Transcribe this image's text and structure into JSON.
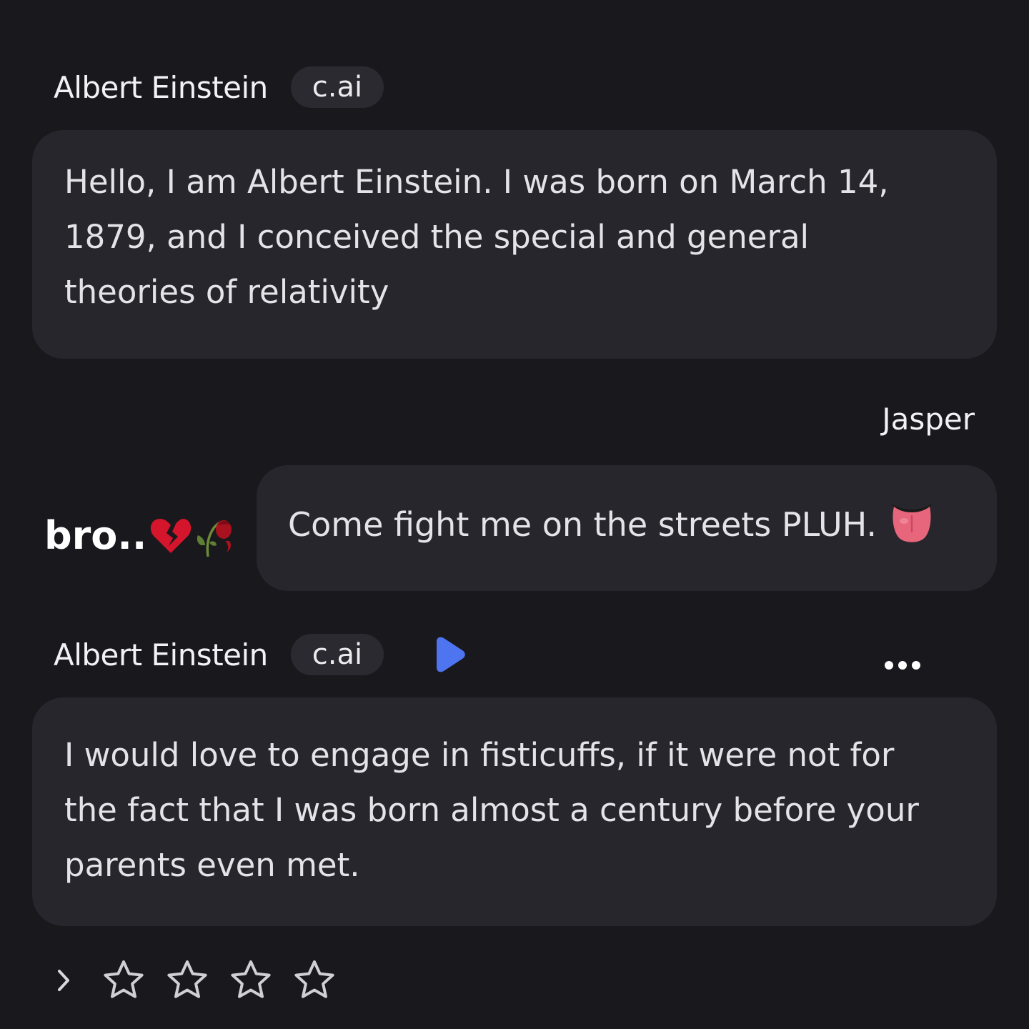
{
  "messages": [
    {
      "sender": "Albert Einstein",
      "badge": "c.ai",
      "text": "Hello, I am Albert Einstein. I was born on March 14, 1879, and I conceived the special and general theories of relativity"
    },
    {
      "sender": "Jasper",
      "text": "Come fight me on the streets PLUH."
    },
    {
      "sender": "Albert Einstein",
      "badge": "c.ai",
      "text": "I would love to engage in fisticuffs, if it were not for the fact that I was born almost a century before your parents even met."
    }
  ],
  "overlay": {
    "caption": "bro..",
    "emoji": [
      "broken-heart-icon",
      "wilted-rose-icon"
    ]
  },
  "user_message_emoji": "tongue-face-icon",
  "rating": {
    "stars": 4,
    "filled": 0
  },
  "colors": {
    "background": "#18181d",
    "bubble": "#26262c",
    "badge": "#2a2a30",
    "play_accent": "#4f74f0"
  },
  "icons": {
    "play": "play-icon",
    "more": "more-options-icon",
    "expand": "chevron-right-icon",
    "star": "star-outline-icon"
  }
}
